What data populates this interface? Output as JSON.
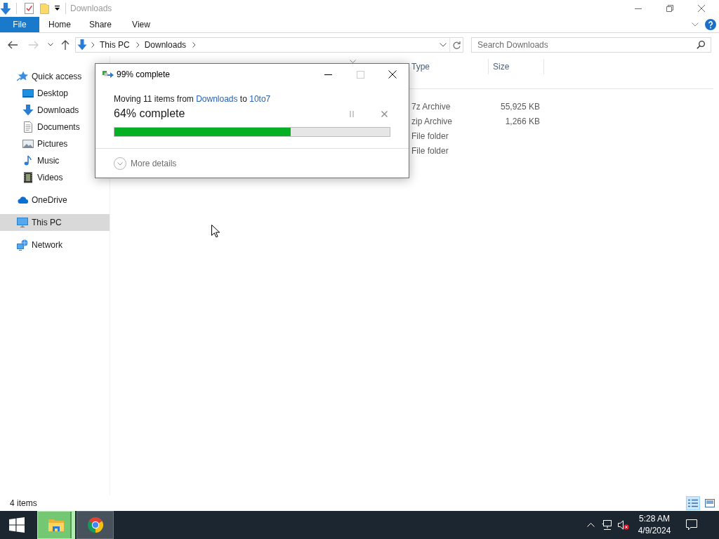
{
  "title_bar": {
    "title": "Downloads"
  },
  "ribbon": {
    "tabs": [
      {
        "label": "File",
        "kind": "file"
      },
      {
        "label": "Home",
        "kind": "tab"
      },
      {
        "label": "Share",
        "kind": "tab"
      },
      {
        "label": "View",
        "kind": "tab"
      }
    ]
  },
  "address_bar": {
    "nav_buttons": [
      {
        "kind": "back",
        "disabled": false
      },
      {
        "kind": "forward",
        "disabled": true
      },
      {
        "kind": "recent",
        "disabled": false
      },
      {
        "kind": "up",
        "disabled": false
      }
    ],
    "path": [
      "This PC",
      "Downloads"
    ]
  },
  "search": {
    "placeholder": "Search Downloads"
  },
  "navigation": {
    "items": [
      {
        "label": "Quick access",
        "kind": "star",
        "selected": false,
        "children": [
          {
            "label": "Desktop",
            "kind": "desktop",
            "selected": false
          },
          {
            "label": "Downloads",
            "kind": "download",
            "selected": false
          },
          {
            "label": "Documents",
            "kind": "document",
            "selected": false
          },
          {
            "label": "Pictures",
            "kind": "picture",
            "selected": false
          },
          {
            "label": "Music",
            "kind": "music",
            "selected": false
          },
          {
            "label": "Videos",
            "kind": "video",
            "selected": false
          }
        ]
      },
      {
        "label": "OneDrive",
        "kind": "cloud",
        "selected": false
      },
      {
        "label": "This PC",
        "kind": "computer",
        "selected": true
      },
      {
        "label": "Network",
        "kind": "network",
        "selected": false
      }
    ]
  },
  "file_list": {
    "columns": [
      "Type",
      "Size"
    ],
    "rows": [
      {
        "type": "7z Archive",
        "size": "55,925 KB"
      },
      {
        "type": "zip Archive",
        "size": "1,266 KB"
      },
      {
        "type": "File folder"
      },
      {
        "type": "File folder"
      }
    ]
  },
  "status_bar": {
    "count": "4 items",
    "views": [
      {
        "kind": "details",
        "selected": true
      },
      {
        "kind": "tiles",
        "selected": false
      }
    ]
  },
  "dialog": {
    "title": "99% complete",
    "maximize_disabled": true,
    "message": [
      {
        "kind": "plain",
        "text": "Moving 11 items from "
      },
      {
        "kind": "link",
        "text": "Downloads"
      },
      {
        "kind": "plain",
        "text": " to "
      },
      {
        "kind": "link",
        "text": "10to7"
      }
    ],
    "status": "64% complete",
    "progress": {
      "level": 0.64
    },
    "more_details": "More details"
  },
  "taskbar": {
    "apps": [
      {
        "kind": "folder",
        "active": false,
        "progress": {
          "level": 0.93
        }
      },
      {
        "kind": "browser",
        "active": true
      }
    ],
    "tray": {
      "volume_muted": true
    },
    "clock": {
      "time": "5:28 AM",
      "date": "4/9/2024"
    }
  }
}
